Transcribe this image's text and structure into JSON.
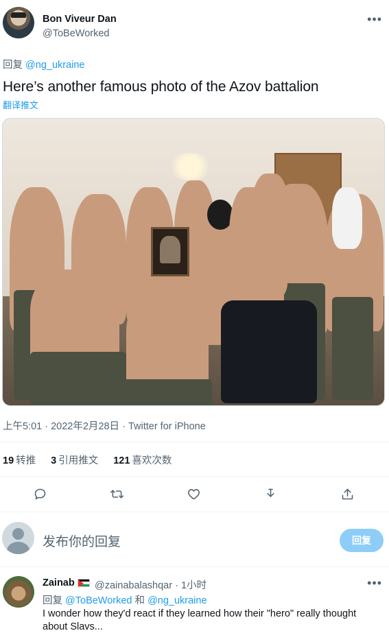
{
  "author": {
    "display_name": "Bon Viveur Dan",
    "handle": "@ToBeWorked"
  },
  "reply_context": {
    "prefix": "回复",
    "mention": "@ng_ukraine"
  },
  "tweet": {
    "text": "Here’s another famous photo of the Azov battalion",
    "translate_label": "翻译推文",
    "timestamp": "上午5:01 · 2022年2月28日 · Twitter for iPhone"
  },
  "stats": [
    {
      "count": "19",
      "label": "转推"
    },
    {
      "count": "3",
      "label": "引用推文"
    },
    {
      "count": "121",
      "label": "喜欢次数"
    }
  ],
  "actions": [
    "reply-icon",
    "retweet-icon",
    "like-icon",
    "bookmark-icon",
    "share-icon"
  ],
  "compose": {
    "placeholder": "发布你的回复",
    "button_label": "回复"
  },
  "reply": {
    "display_name": "Zainab",
    "flag": "palestine-flag-icon",
    "handle_time": "@zainabalashqar · 1小时",
    "reply_prefix": "回复",
    "mention_1": "@ToBeWorked",
    "conjunction": "和",
    "mention_2": "@ng_ukraine",
    "text": "I wonder how they'd react if they learned how their \"hero\" really thought about Slavs..."
  },
  "colors": {
    "accent": "#1d9bf0",
    "muted_text": "#536471",
    "primary_text": "#0f1419",
    "button_disabled": "#8ecdf8"
  }
}
